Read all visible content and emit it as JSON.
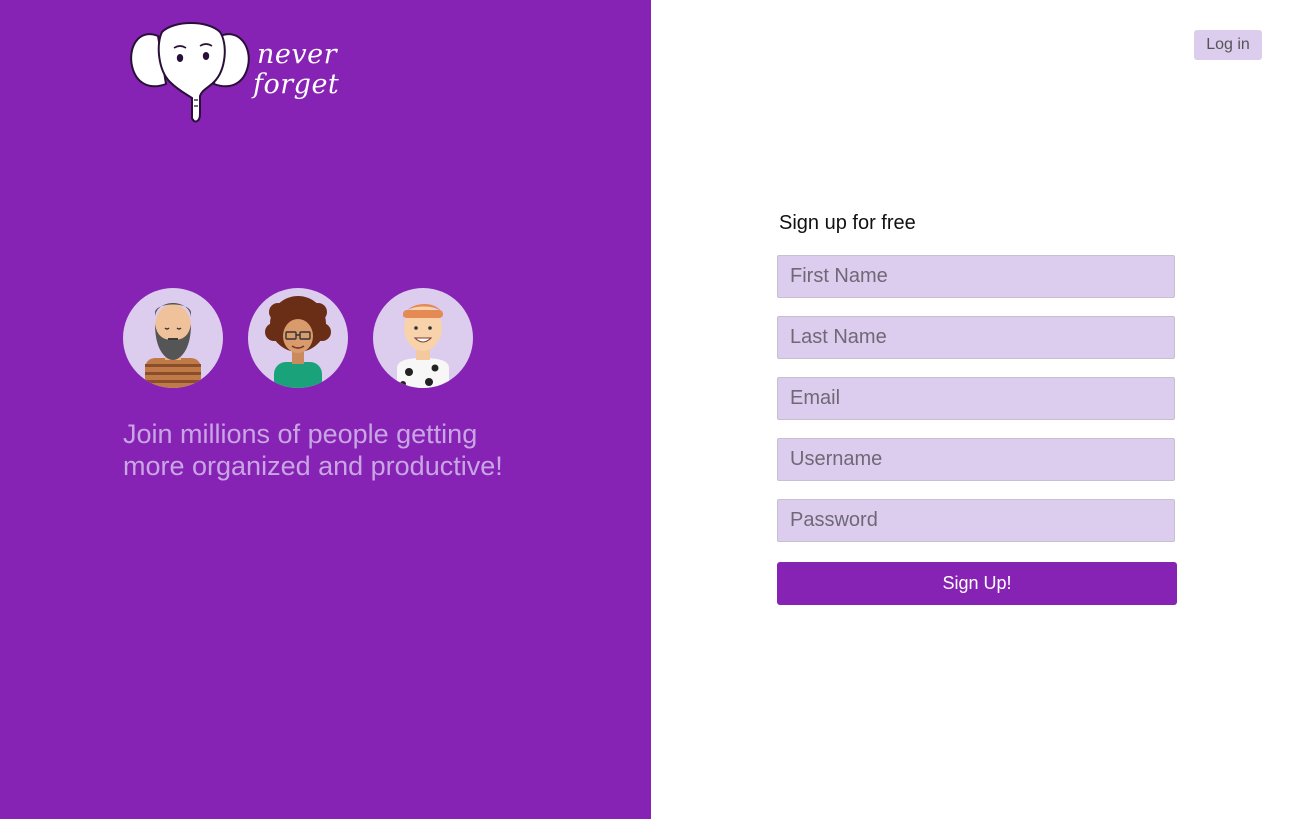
{
  "brand": {
    "logo_line1": "never",
    "logo_line2": "forget",
    "icon": "elephant-icon",
    "accent_color": "#8623b5",
    "field_color": "#dccdee"
  },
  "header": {
    "login_label": "Log in"
  },
  "hero": {
    "avatars": [
      "bearded-man-avatar",
      "curly-hair-woman-avatar",
      "smiling-man-avatar"
    ],
    "tagline": "Join millions of people getting more organized and productive!"
  },
  "signup_form": {
    "title": "Sign up for free",
    "fields": {
      "first_name": "First Name",
      "last_name": "Last Name",
      "email": "Email",
      "username": "Username",
      "password": "Password"
    },
    "submit_label": "Sign Up!"
  }
}
